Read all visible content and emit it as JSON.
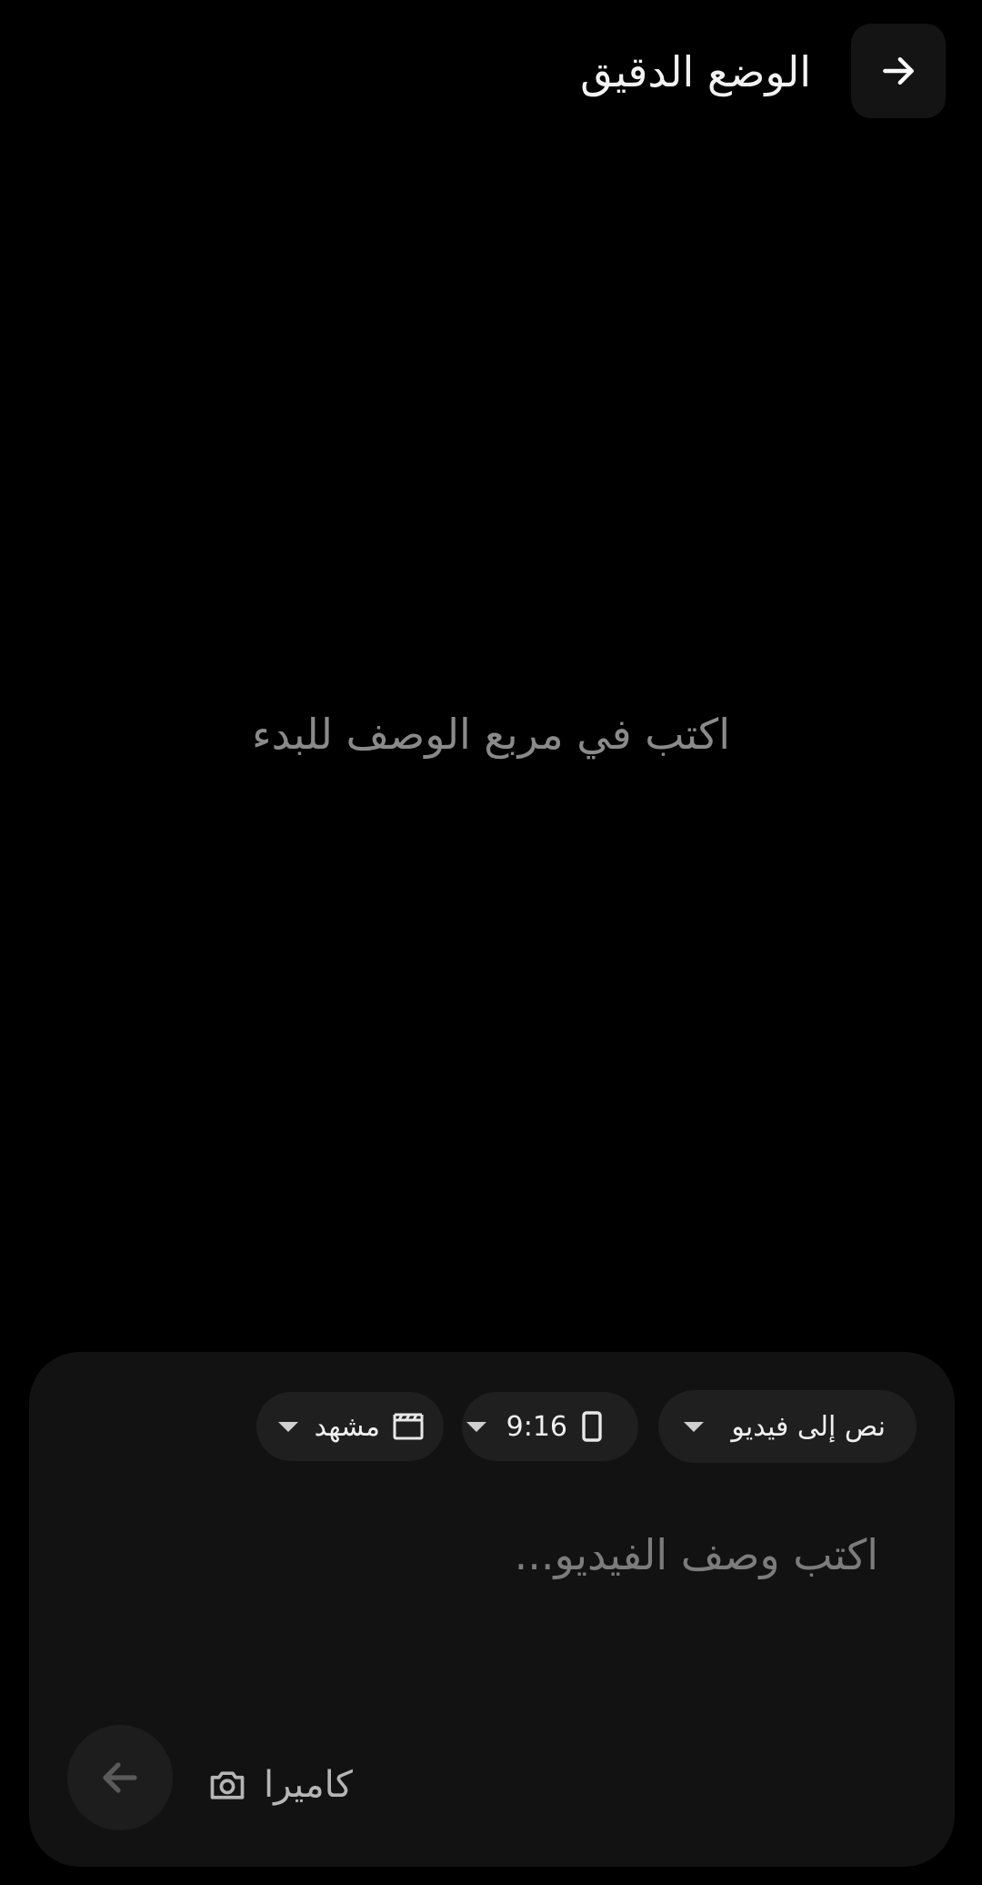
{
  "header": {
    "title": "الوضع الدقيق",
    "back_icon": "arrow-right-icon"
  },
  "main": {
    "empty_hint": "اكتب في مربع الوصف للبدء"
  },
  "composer": {
    "mode_chip": {
      "label": "نص إلى فيديو",
      "icon": "chevron-down-icon"
    },
    "ratio_chip": {
      "label": "9:16",
      "icon": "phone-icon"
    },
    "scene_chip": {
      "label": "مشهد",
      "icon": "clapperboard-icon"
    },
    "prompt_placeholder": "اكتب وصف الفيديو...",
    "camera_label": "كاميرا",
    "camera_icon": "camera-icon",
    "send_icon": "arrow-left-icon"
  },
  "colors": {
    "background": "#000000",
    "panel": "#121212",
    "chip": "#1f1f1f",
    "muted_text": "#8a8a8a"
  }
}
